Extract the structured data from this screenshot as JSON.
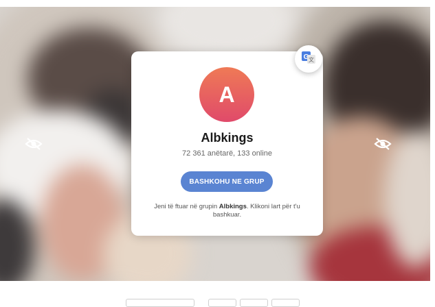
{
  "group": {
    "avatar_letter": "A",
    "name": "Albkings",
    "members_text": "72 361 anëtarë, 133 online",
    "join_label": "BASHKOHU NE GRUP",
    "invite_prefix": "Jeni të ftuar në grupin ",
    "invite_group": "Albkings",
    "invite_suffix": ". Klikoni lart për t'u bashkuar."
  },
  "icons": {
    "left_preview": "eye-slash-icon",
    "right_preview": "eye-slash-icon",
    "translate": "google-translate-icon"
  },
  "colors": {
    "join_button": "#5a84d2",
    "avatar_top": "#ef7a56",
    "avatar_bottom": "#e04a6a"
  }
}
